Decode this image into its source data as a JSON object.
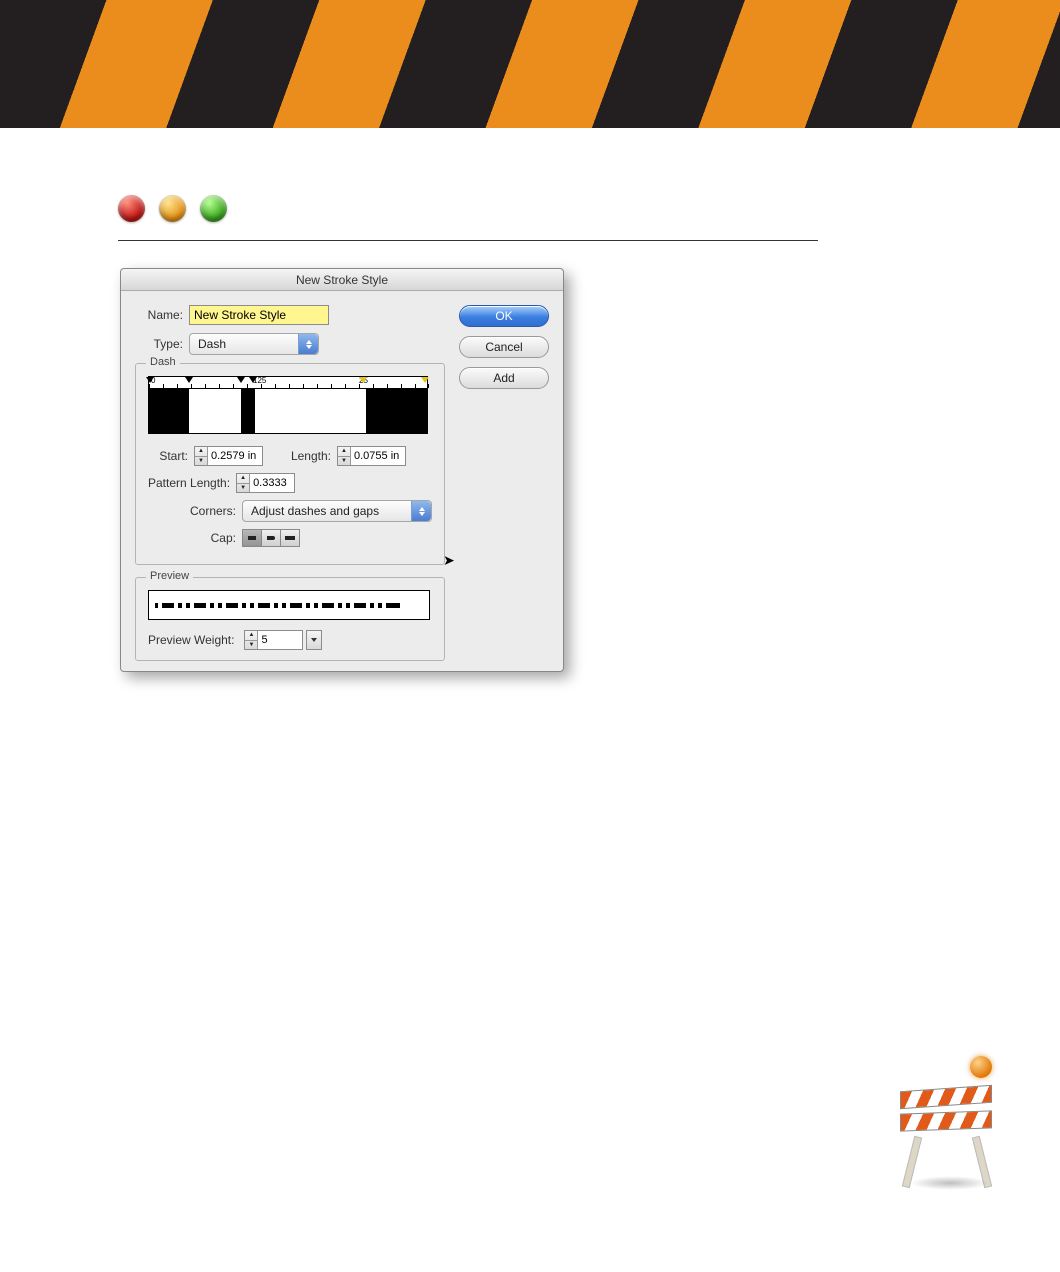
{
  "dialog": {
    "title": "New Stroke Style",
    "name_label": "Name:",
    "name_value": "New Stroke Style",
    "type_label": "Type:",
    "type_value": "Dash",
    "buttons": {
      "ok": "OK",
      "cancel": "Cancel",
      "add": "Add"
    },
    "dash_group": {
      "title": "Dash",
      "ruler_left": "0",
      "ruler_mid": "125",
      "ruler_right": "25",
      "start_label": "Start:",
      "start_value": "0.2579 in",
      "length_label": "Length:",
      "length_value": "0.0755 in",
      "pattern_length_label": "Pattern Length:",
      "pattern_length_value": "0.3333",
      "corners_label": "Corners:",
      "corners_value": "Adjust dashes and gaps",
      "cap_label": "Cap:"
    },
    "preview_group": {
      "title": "Preview",
      "weight_label": "Preview Weight:",
      "weight_value": "5"
    }
  }
}
